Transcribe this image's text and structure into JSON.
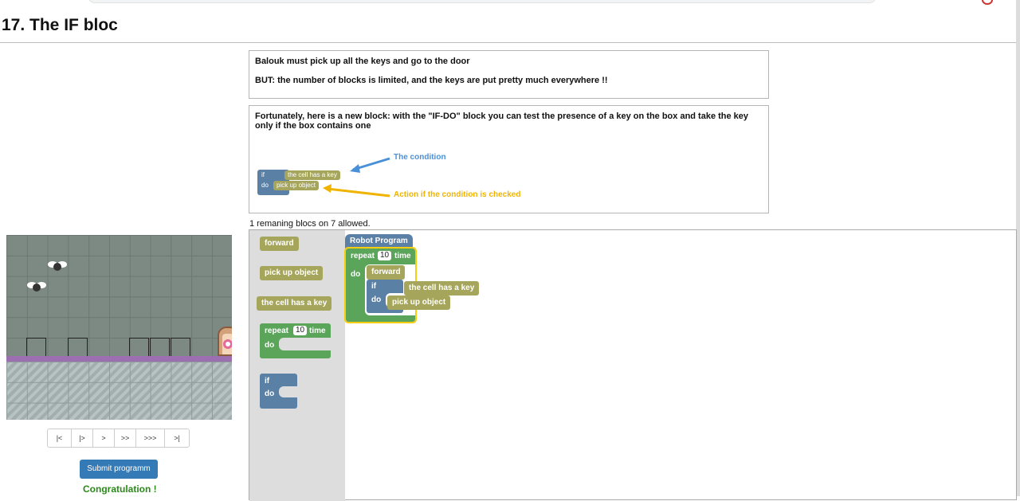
{
  "page": {
    "title": "17. The IF bloc"
  },
  "instructions": {
    "line1": "Balouk must pick up all the keys and go to the door",
    "line2": "BUT: the number of blocks is limited, and the keys are put pretty much everywhere !!",
    "intro": "Fortunately, here is a new block: with the \"IF-DO\" block you can test the presence of a key on the box and take the key only if the box contains one",
    "figure": {
      "if_label": "if",
      "do_label": "do",
      "condition_block": "the cell has a key",
      "action_block": "pick up object",
      "annotation_condition": "The condition",
      "annotation_action": "Action if the condition is checked",
      "condition_color": "#4a90d9",
      "action_color": "#f0b400"
    }
  },
  "remaining": "1 remaning blocs on 7 allowed.",
  "player_controls": {
    "buttons": [
      "|<",
      "|>",
      ">",
      ">>",
      ">>>",
      ">|"
    ],
    "submit_label": "Submit programm",
    "status": "Congratulation !"
  },
  "toolbox": {
    "forward": "forward",
    "pick_up": "pick up object",
    "condition": "the cell has a key",
    "repeat_label": "repeat",
    "repeat_value": "10",
    "repeat_unit": "time",
    "do_label": "do",
    "if_label": "if",
    "if_do_label": "do"
  },
  "program": {
    "header": "Robot Program",
    "repeat_label": "repeat",
    "repeat_value": "10",
    "repeat_unit": "time",
    "do_label": "do",
    "forward": "forward",
    "if_label": "if",
    "condition": "the cell has a key",
    "if_do_label": "do",
    "action": "pick up object"
  },
  "colors": {
    "action_block": "#a5a55b",
    "loop_block": "#5ba55b",
    "logic_block": "#5b80a5",
    "header_block": "#5b80a5",
    "submit_button": "#337ab7",
    "success_text": "#2a8a18"
  }
}
